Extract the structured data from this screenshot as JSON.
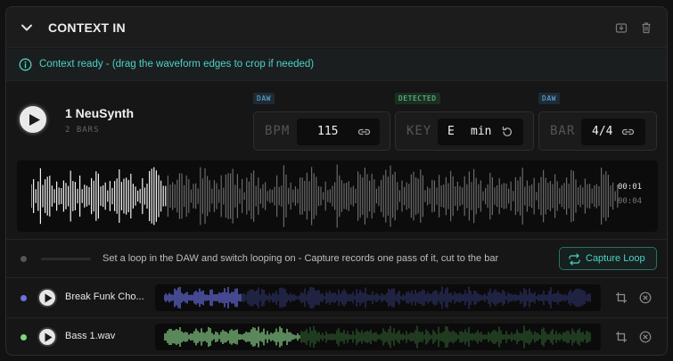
{
  "header": {
    "title": "CONTEXT IN",
    "icons": [
      "chevron-down-icon",
      "download-icon",
      "trash-icon"
    ]
  },
  "banner": {
    "text": "Context ready - (drag the waveform edges to crop if needed)",
    "icon": "info-icon",
    "color": "#4fd1c5"
  },
  "context": {
    "track_name": "1 NeuSynth",
    "track_sub": "2 BARS",
    "bpm": {
      "tag": "DAW",
      "label": "BPM",
      "value": "115",
      "icon": "link-icon"
    },
    "key": {
      "tag": "DETECTED",
      "label": "KEY",
      "root": "E",
      "mode": "min",
      "icon": "refresh-icon"
    },
    "bar": {
      "tag": "DAW",
      "label": "BAR",
      "value": "4/4",
      "icon": "link-icon"
    },
    "time_current": "00:01",
    "time_total": "00:04",
    "played_fraction": 0.23
  },
  "capture": {
    "text": "Set a loop in the DAW and switch looping on - Capture records one pass of it, cut to the bar",
    "button_label": "Capture Loop",
    "icon": "repeat-icon"
  },
  "tracks": [
    {
      "name": "Break Funk Cho...",
      "dot_color": "#6b72e8",
      "wave_color": "#6b72e8",
      "played_fraction": 0.18,
      "icons": [
        "crop-icon",
        "close-circle-icon"
      ]
    },
    {
      "name": "Bass 1.wav",
      "dot_color": "#7ed47e",
      "wave_color": "#8fdc8f",
      "played_fraction": 0.32,
      "icons": [
        "crop-icon",
        "close-circle-icon"
      ]
    }
  ]
}
